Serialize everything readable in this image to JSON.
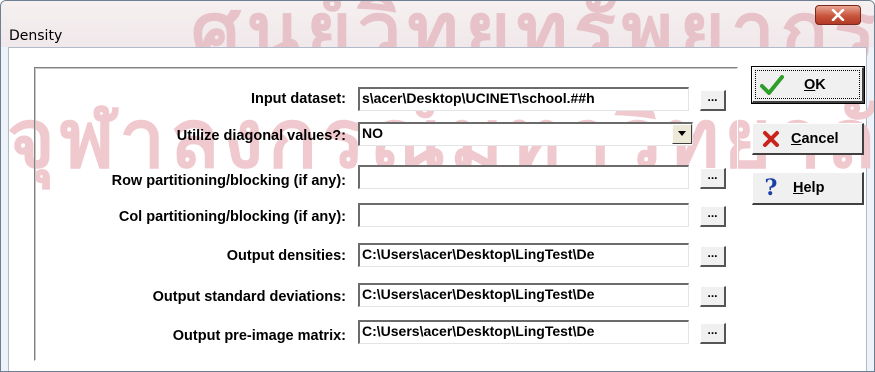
{
  "window": {
    "title": "Density",
    "close_icon": "close-x-icon"
  },
  "form": {
    "fields": [
      {
        "label": "Input dataset:",
        "value": "s\\acer\\Desktop\\UCINET\\school.##h"
      },
      {
        "label": "Utilize diagonal values?:",
        "value": "NO"
      },
      {
        "label": "Row partitioning/blocking (if any):",
        "value": ""
      },
      {
        "label": "Col partitioning/blocking (if any):",
        "value": ""
      },
      {
        "label": "Output densities:",
        "value": "C:\\Users\\acer\\Desktop\\LingTest\\De"
      },
      {
        "label": "Output standard deviations:",
        "value": "C:\\Users\\acer\\Desktop\\LingTest\\De"
      },
      {
        "label": "Output pre-image matrix:",
        "value": "C:\\Users\\acer\\Desktop\\LingTest\\De"
      }
    ],
    "browse_label": "...",
    "dropdown_icon": "triangle-down-icon"
  },
  "buttons": {
    "ok": {
      "mnemonic": "O",
      "rest": "K",
      "icon": "checkmark-icon"
    },
    "cancel": {
      "mnemonic": "C",
      "rest": "ancel",
      "icon": "x-mark-icon"
    },
    "help": {
      "mnemonic": "H",
      "rest": "elp",
      "icon": "question-mark-icon"
    }
  },
  "watermark": {
    "top_text": "ศูนย์วิทยทรัพยากร",
    "mid_text": "จุฬาลงกรณ์มหาวิทยาลัย",
    "color": "#f0c9cf"
  },
  "colors": {
    "ok_check": "#2e9e2a",
    "cancel_x": "#c9241c",
    "help_q": "#1a3fa8",
    "close_button": "#c8553d"
  }
}
